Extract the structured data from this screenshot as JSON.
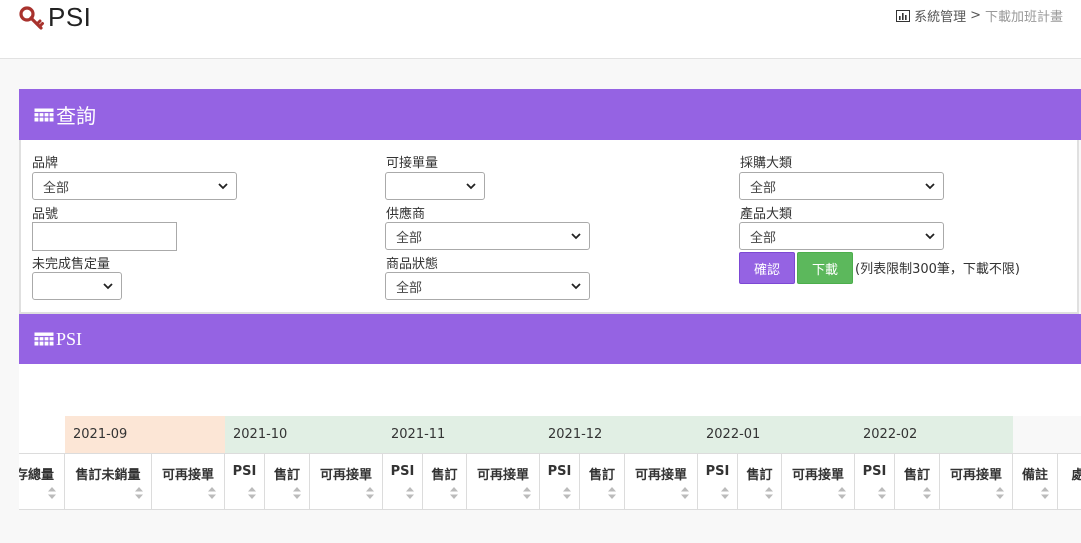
{
  "app": {
    "title": "PSI"
  },
  "breadcrumb": {
    "parent": "系統管理",
    "separator": ">",
    "current": "下載加班計畫"
  },
  "query_panel": {
    "title": "查詢",
    "fields": {
      "brand": {
        "label": "品牌",
        "value": "全部"
      },
      "sku": {
        "label": "品號",
        "value": ""
      },
      "unfinished": {
        "label": "未完成售定量",
        "value": ""
      },
      "orderable": {
        "label": "可接單量",
        "value": ""
      },
      "supplier": {
        "label": "供應商",
        "value": "全部"
      },
      "status": {
        "label": "商品狀態",
        "value": "全部"
      },
      "purchase_cat": {
        "label": "採購大類",
        "value": "全部"
      },
      "product_cat": {
        "label": "產品大類",
        "value": "全部"
      }
    },
    "confirm_label": "確認",
    "download_label": "下載",
    "note": "(列表限制300筆，下載不限)"
  },
  "psi_panel": {
    "title": "PSI"
  },
  "table": {
    "months": [
      "2021-09",
      "2021-10",
      "2021-11",
      "2021-12",
      "2022-01",
      "2022-02"
    ],
    "month_colors": {
      "first": "#fce6d6",
      "rest": "#e1efe4"
    },
    "headers": [
      "存總量",
      "售訂未銷量",
      "可再接單",
      "PSI",
      "售訂",
      "可再接單",
      "PSI",
      "售訂",
      "可再接單",
      "PSI",
      "售訂",
      "可再接單",
      "PSI",
      "售訂",
      "可再接單",
      "PSI",
      "售訂",
      "可再接單",
      "備註",
      "處"
    ]
  }
}
